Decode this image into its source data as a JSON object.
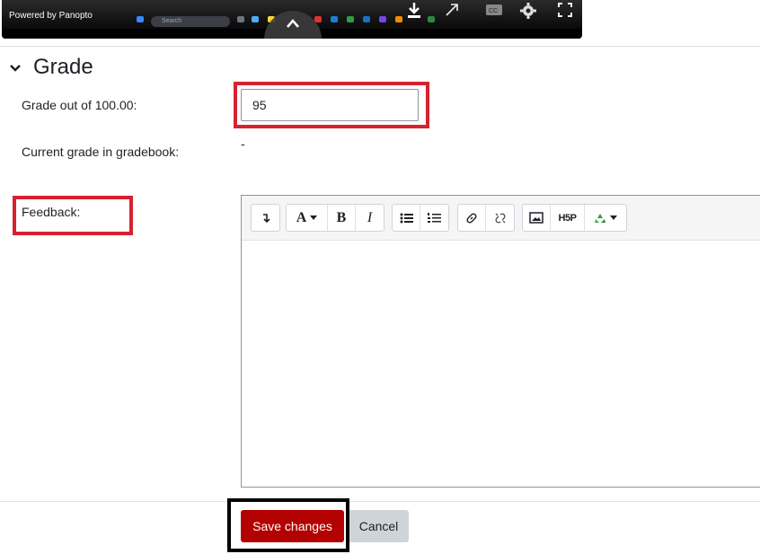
{
  "video": {
    "powered_by": "Powered by Panopto",
    "taskbar_search": "Search"
  },
  "section": {
    "title": "Grade"
  },
  "form": {
    "grade_label": "Grade out of 100.00:",
    "grade_value": "95",
    "current_grade_label": "Current grade in gradebook:",
    "current_grade_value": "-",
    "feedback_label": "Feedback:"
  },
  "toolbar": {
    "collapse": "↴",
    "font_style": "A",
    "bold": "B",
    "italic": "I",
    "h5p": "H5P"
  },
  "actions": {
    "save_label": "Save changes",
    "cancel_label": "Cancel"
  },
  "colors": {
    "primary": "#b30000",
    "highlight_red": "#d7212f",
    "highlight_black": "#000000"
  }
}
